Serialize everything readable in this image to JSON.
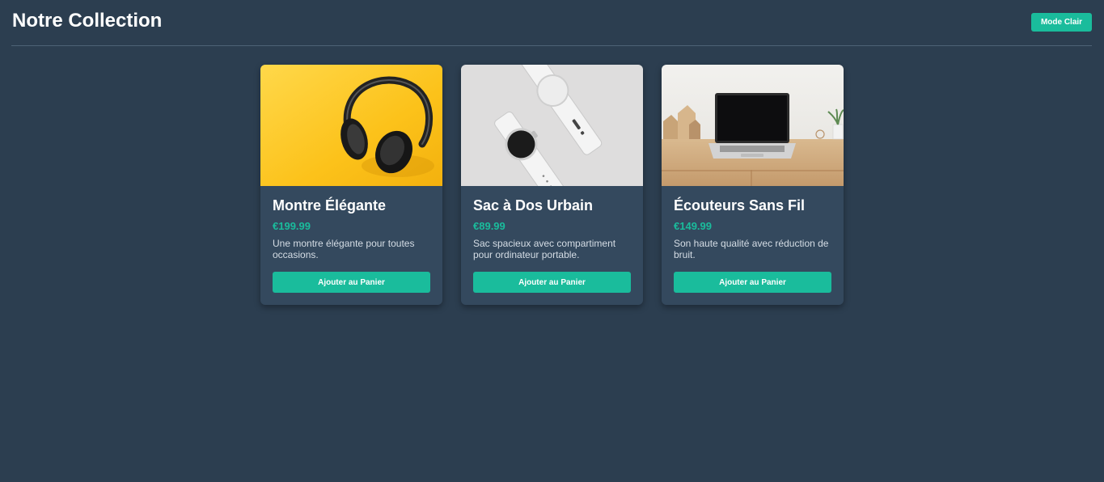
{
  "header": {
    "title": "Notre Collection",
    "mode_button": "Mode Clair"
  },
  "colors": {
    "background": "#2c3e50",
    "card": "#34495e",
    "accent": "#1abc9c"
  },
  "products": [
    {
      "name": "Montre Élégante",
      "price": "€199.99",
      "description": "Une montre élégante pour toutes occasions.",
      "button": "Ajouter au Panier",
      "image": "headphones-photo"
    },
    {
      "name": "Sac à Dos Urbain",
      "price": "€89.99",
      "description": "Sac spacieux avec compartiment pour ordinateur portable.",
      "button": "Ajouter au Panier",
      "image": "smartwatch-photo"
    },
    {
      "name": "Écouteurs Sans Fil",
      "price": "€149.99",
      "description": "Son haute qualité avec réduction de bruit.",
      "button": "Ajouter au Panier",
      "image": "laptop-desk-photo"
    }
  ]
}
